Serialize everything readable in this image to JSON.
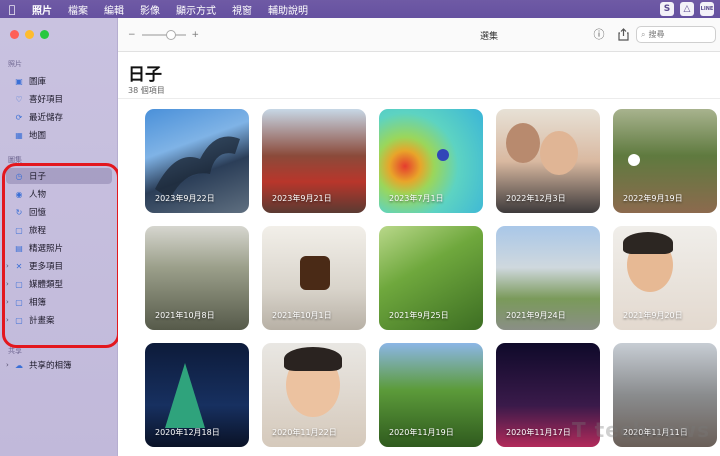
{
  "menubar": {
    "apple": "",
    "items": [
      "照片",
      "檔案",
      "編輯",
      "影像",
      "顯示方式",
      "視窗",
      "輔助說明"
    ],
    "tray": [
      "S",
      "△",
      "LINE"
    ]
  },
  "sidebar": {
    "sections": {
      "photos": "照片",
      "albums": "圖集",
      "shared": "共享"
    },
    "items": [
      {
        "label": "圖庫",
        "icon": "▣"
      },
      {
        "label": "喜好項目",
        "icon": "♡"
      },
      {
        "label": "最近儲存",
        "icon": "⟳"
      },
      {
        "label": "地圖",
        "icon": "▦"
      },
      {
        "label": "日子",
        "icon": "◷"
      },
      {
        "label": "人物",
        "icon": "◉"
      },
      {
        "label": "回憶",
        "icon": "↻"
      },
      {
        "label": "旅程",
        "icon": "▢"
      },
      {
        "label": "精選照片",
        "icon": "▤"
      },
      {
        "label": "更多項目",
        "icon": "✕"
      },
      {
        "label": "媒體類型",
        "icon": "▢"
      },
      {
        "label": "相簿",
        "icon": "▢"
      },
      {
        "label": "計畫案",
        "icon": "▢"
      },
      {
        "label": "共享的相簿",
        "icon": "☁"
      }
    ]
  },
  "toolbar": {
    "title": "選集",
    "zoom_minus": "−",
    "zoom_plus": "+",
    "search_placeholder": "搜尋"
  },
  "content": {
    "title": "日子",
    "subtitle": "38 個項目"
  },
  "tiles": [
    {
      "date": "2023年9月22日"
    },
    {
      "date": "2023年9月21日"
    },
    {
      "date": "2023年7月1日"
    },
    {
      "date": "2022年12月3日"
    },
    {
      "date": "2022年9月19日"
    },
    {
      "date": "2021年10月8日"
    },
    {
      "date": "2021年10月1日"
    },
    {
      "date": "2021年9月25日"
    },
    {
      "date": "2021年9月24日"
    },
    {
      "date": "2021年9月20日"
    },
    {
      "date": "2020年12月18日"
    },
    {
      "date": "2020年11月22日"
    },
    {
      "date": "2020年11月19日"
    },
    {
      "date": "2020年11月17日"
    },
    {
      "date": "2020年11月11日"
    }
  ],
  "watermark": "T technews"
}
